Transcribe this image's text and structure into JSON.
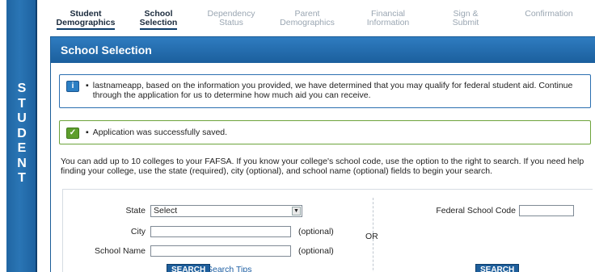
{
  "sidebar": {
    "letters": [
      "S",
      "T",
      "U",
      "D",
      "E",
      "N",
      "T"
    ]
  },
  "steps": [
    {
      "label": "Student\nDemographics",
      "state": "done"
    },
    {
      "label": "School\nSelection",
      "state": "active"
    },
    {
      "label": "Dependency\nStatus",
      "state": "pending"
    },
    {
      "label": "Parent\nDemographics",
      "state": "pending"
    },
    {
      "label": "Financial\nInformation",
      "state": "pending"
    },
    {
      "label": "Sign &\nSubmit",
      "state": "pending"
    },
    {
      "label": "Confirmation",
      "state": "pending"
    }
  ],
  "panel": {
    "title": "School Selection",
    "info_icon": "i",
    "info_message": "lastnameapp, based on the information you provided, we have determined that you may qualify for federal student aid. Continue through the application for us to determine how much aid you can receive.",
    "success_icon": "check-icon",
    "success_message": "Application was successfully saved.",
    "intro_text": "You can add up to 10 colleges to your FAFSA. If you know your college's school code, use the option to the right to search. If you need help finding your college, use the state (required), city (optional), and school name (optional) fields to begin your search."
  },
  "form": {
    "state_label": "State",
    "state_value": "Select",
    "city_label": "City",
    "city_optional": "(optional)",
    "school_label": "School Name",
    "school_optional": "(optional)",
    "or_label": "OR",
    "code_label": "Federal School Code",
    "search_button": "SEARCH",
    "search_tips": "Search Tips",
    "code_search_button": "SEARCH"
  },
  "colors": {
    "accent": "#1b5f9d",
    "success": "#6da33b"
  }
}
